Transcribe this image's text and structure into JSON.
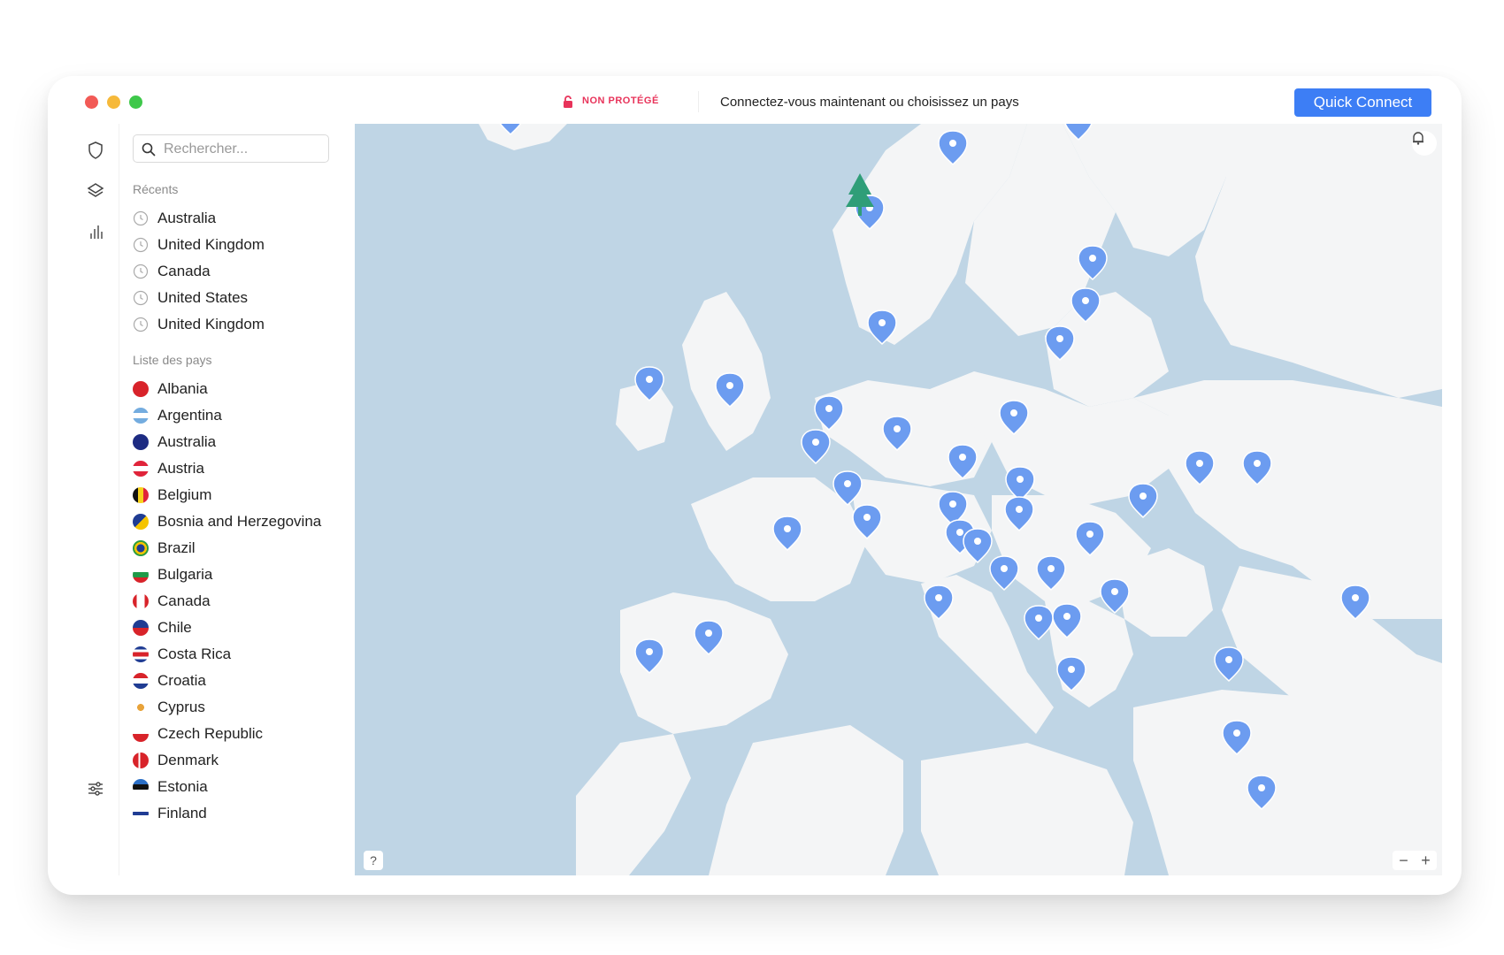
{
  "status": {
    "label": "NON PROTÉGÉ",
    "message": "Connectez-vous maintenant ou choisissez un pays"
  },
  "quick_connect_label": "Quick Connect",
  "search": {
    "placeholder": "Rechercher..."
  },
  "recents": {
    "title": "Récents",
    "items": [
      "Australia",
      "United Kingdom",
      "Canada",
      "United States",
      "United Kingdom"
    ]
  },
  "countries": {
    "title": "Liste des pays",
    "items": [
      {
        "name": "Albania",
        "flag": "albania-flag-icon"
      },
      {
        "name": "Argentina",
        "flag": "argentina-flag-icon"
      },
      {
        "name": "Australia",
        "flag": "australia-flag-icon"
      },
      {
        "name": "Austria",
        "flag": "austria-flag-icon"
      },
      {
        "name": "Belgium",
        "flag": "belgium-flag-icon"
      },
      {
        "name": "Bosnia and Herzegovina",
        "flag": "bosnia-flag-icon"
      },
      {
        "name": "Brazil",
        "flag": "brazil-flag-icon"
      },
      {
        "name": "Bulgaria",
        "flag": "bulgaria-flag-icon"
      },
      {
        "name": "Canada",
        "flag": "canada-flag-icon"
      },
      {
        "name": "Chile",
        "flag": "chile-flag-icon"
      },
      {
        "name": "Costa Rica",
        "flag": "costa-rica-flag-icon"
      },
      {
        "name": "Croatia",
        "flag": "croatia-flag-icon"
      },
      {
        "name": "Cyprus",
        "flag": "cyprus-flag-icon"
      },
      {
        "name": "Czech Republic",
        "flag": "czech-flag-icon"
      },
      {
        "name": "Denmark",
        "flag": "denmark-flag-icon"
      },
      {
        "name": "Estonia",
        "flag": "estonia-flag-icon"
      },
      {
        "name": "Finland",
        "flag": "finland-flag-icon"
      }
    ]
  },
  "map": {
    "help_label": "?",
    "zoom_out_label": "−",
    "zoom_in_label": "+"
  },
  "colors": {
    "accent": "#3d7ef5",
    "warning": "#e8335a",
    "water": "#bfd5e5",
    "land": "#f4f5f6",
    "pin": "#6c9cf0"
  }
}
